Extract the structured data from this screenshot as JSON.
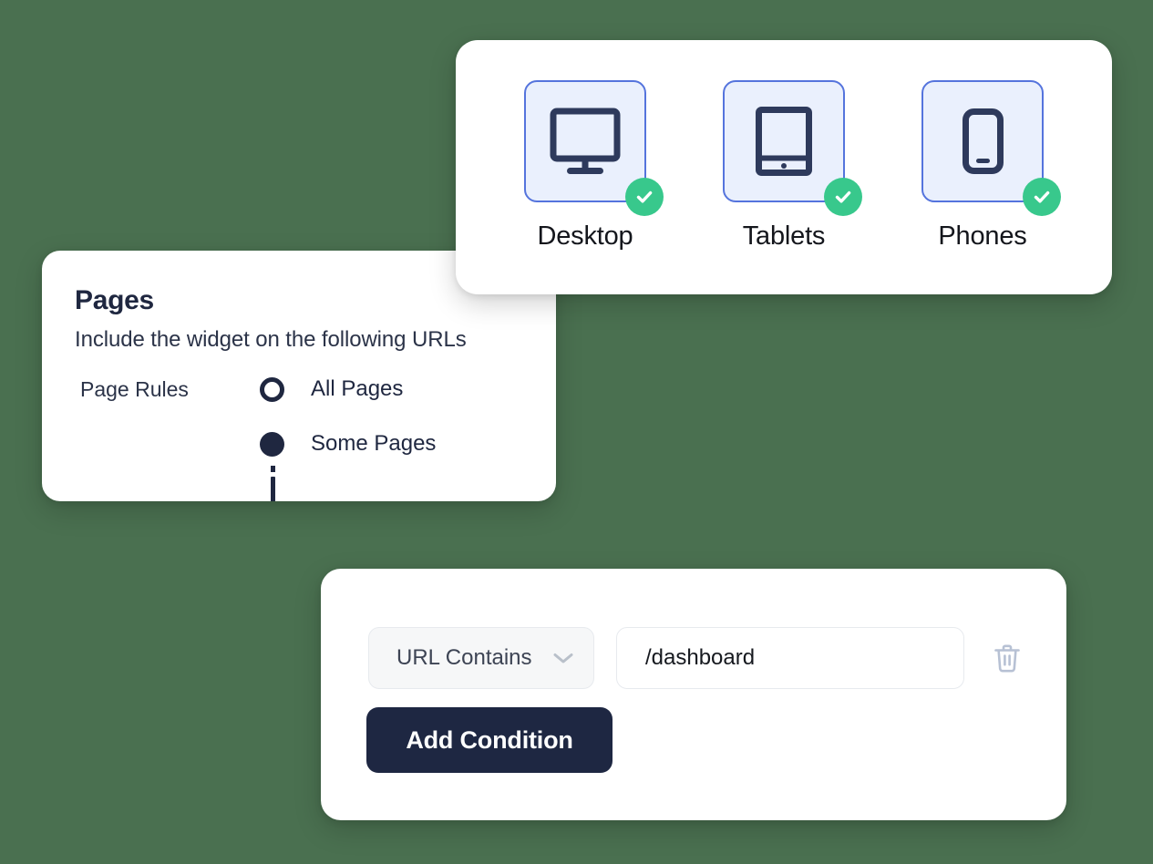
{
  "background_color": "#4a7050",
  "devices_card": {
    "accent_border": "#5574dd",
    "tile_background": "#eaf0fd",
    "icon_color": "#2e3a5c",
    "check_color": "#38c88c",
    "items": [
      {
        "label": "Desktop",
        "icon": "desktop-monitor-icon",
        "checked": true,
        "check_icon": "check-icon"
      },
      {
        "label": "Tablets",
        "icon": "tablet-icon",
        "checked": true,
        "check_icon": "check-icon"
      },
      {
        "label": "Phones",
        "icon": "phone-icon",
        "checked": true,
        "check_icon": "check-icon"
      }
    ]
  },
  "pages_card": {
    "title": "Pages",
    "subtitle": "Include the widget on the following  URLs",
    "field_label": "Page Rules",
    "radio_color": "#1f2740",
    "options": [
      {
        "label": "All Pages",
        "selected": false
      },
      {
        "label": "Some Pages",
        "selected": true
      }
    ]
  },
  "conditions_card": {
    "condition": {
      "operator": "URL Contains",
      "operator_chevron_icon": "chevron-down-icon",
      "value": "/dashboard",
      "value_placeholder": "/dashboard",
      "delete_icon": "trash-icon"
    },
    "add_button": {
      "label": "Add Condition",
      "color": "#1e2742"
    }
  }
}
